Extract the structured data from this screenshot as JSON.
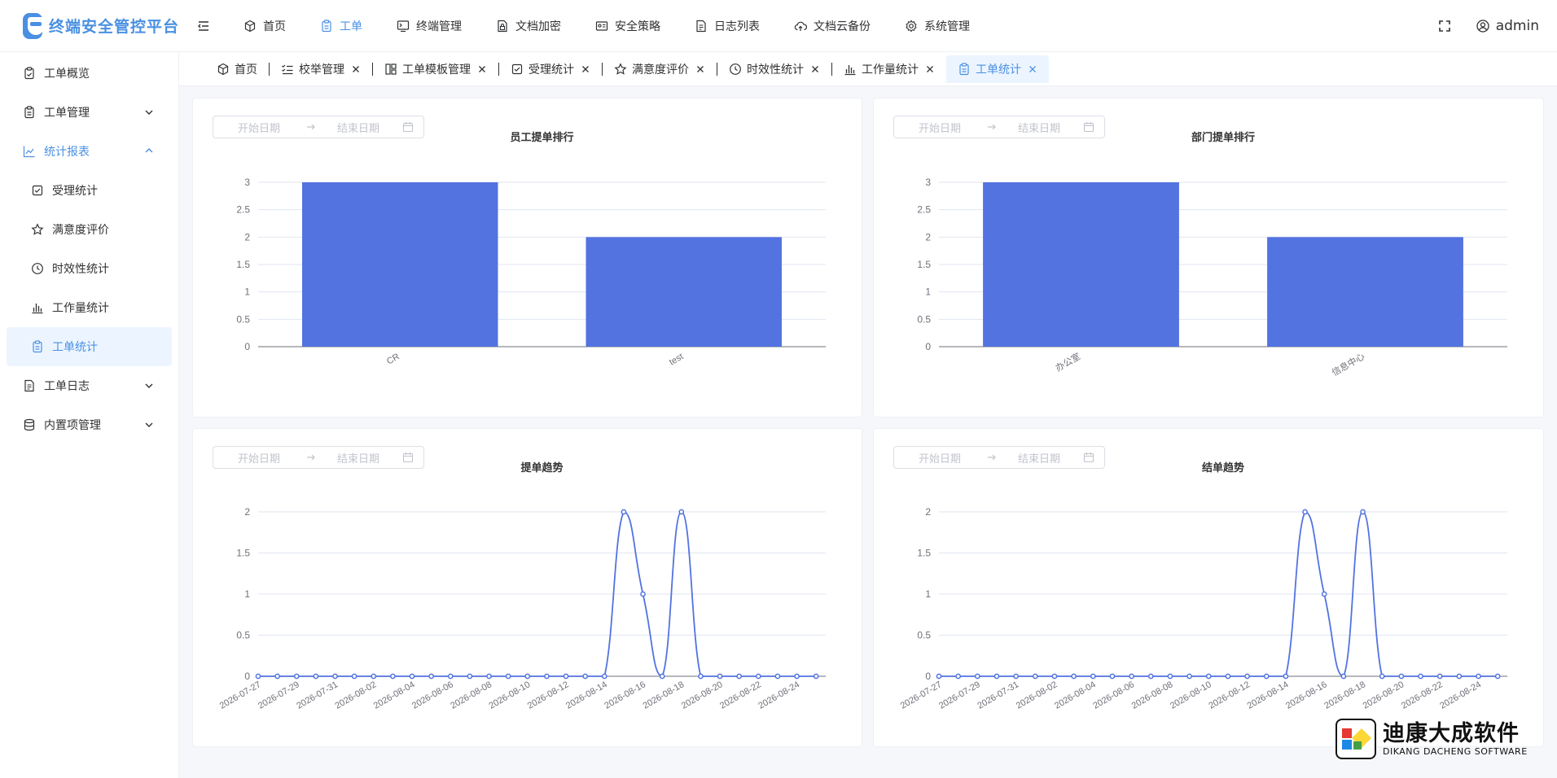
{
  "app": {
    "title": "终端安全管控平台"
  },
  "topnav": [
    {
      "label": "首页",
      "icon": "cube-icon"
    },
    {
      "label": "工单",
      "icon": "clipboard-icon",
      "active": true
    },
    {
      "label": "终端管理",
      "icon": "monitor-icon"
    },
    {
      "label": "文档加密",
      "icon": "lock-file-icon"
    },
    {
      "label": "安全策略",
      "icon": "id-card-icon"
    },
    {
      "label": "日志列表",
      "icon": "document-icon"
    },
    {
      "label": "文档云备份",
      "icon": "cloud-upload-icon"
    },
    {
      "label": "系统管理",
      "icon": "gear-icon"
    }
  ],
  "user": {
    "name": "admin"
  },
  "sidebar": {
    "items": [
      {
        "label": "工单概览",
        "icon": "clipboard-check-icon",
        "expandable": false
      },
      {
        "label": "工单管理",
        "icon": "clipboard-icon",
        "expandable": true
      },
      {
        "label": "统计报表",
        "icon": "line-chart-icon",
        "expandable": true,
        "open": true
      }
    ],
    "subitems": [
      {
        "label": "受理统计",
        "icon": "check-square-icon"
      },
      {
        "label": "满意度评价",
        "icon": "star-icon"
      },
      {
        "label": "时效性统计",
        "icon": "clock-icon"
      },
      {
        "label": "工作量统计",
        "icon": "bar-chart-icon"
      },
      {
        "label": "工单统计",
        "icon": "clipboard-icon",
        "active": true
      }
    ],
    "after": [
      {
        "label": "工单日志",
        "icon": "document-icon",
        "expandable": true
      },
      {
        "label": "内置项管理",
        "icon": "database-icon",
        "expandable": true
      }
    ]
  },
  "tabs": [
    {
      "label": "首页",
      "icon": "cube-icon",
      "closable": false
    },
    {
      "label": "校举管理",
      "icon": "list-check-icon",
      "closable": true
    },
    {
      "label": "工单模板管理",
      "icon": "template-icon",
      "closable": true
    },
    {
      "label": "受理统计",
      "icon": "check-square-icon",
      "closable": true
    },
    {
      "label": "满意度评价",
      "icon": "star-icon",
      "closable": true
    },
    {
      "label": "时效性统计",
      "icon": "clock-icon",
      "closable": true
    },
    {
      "label": "工作量统计",
      "icon": "bar-chart-icon",
      "closable": true
    },
    {
      "label": "工单统计",
      "icon": "clipboard-icon",
      "closable": true,
      "active": true
    }
  ],
  "date_filter": {
    "start_placeholder": "开始日期",
    "end_placeholder": "结束日期"
  },
  "colors": {
    "accent": "#4a90e2",
    "series": "#5273e0",
    "grid": "#e0e6f1",
    "axis": "#6e7079"
  },
  "chart_data": [
    {
      "type": "bar",
      "title": "员工提单排行",
      "categories": [
        "CR",
        "test"
      ],
      "values": [
        3,
        2
      ],
      "ylim": [
        0,
        3
      ],
      "yticks": [
        "0",
        "0.5",
        "1",
        "1.5",
        "2",
        "2.5",
        "3"
      ]
    },
    {
      "type": "bar",
      "title": "部门提单排行",
      "categories": [
        "办公室",
        "信息中心"
      ],
      "values": [
        3,
        2
      ],
      "ylim": [
        0,
        3
      ],
      "yticks": [
        "0",
        "0.5",
        "1",
        "1.5",
        "2",
        "2.5",
        "3"
      ]
    },
    {
      "type": "line",
      "title": "提单趋势",
      "x": [
        "2026-07-27",
        "2026-07-28",
        "2026-07-29",
        "2026-07-30",
        "2026-07-31",
        "2026-08-01",
        "2026-08-02",
        "2026-08-03",
        "2026-08-04",
        "2026-08-05",
        "2026-08-06",
        "2026-08-07",
        "2026-08-08",
        "2026-08-09",
        "2026-08-10",
        "2026-08-11",
        "2026-08-12",
        "2026-08-13",
        "2026-08-14",
        "2026-08-15",
        "2026-08-16",
        "2026-08-17",
        "2026-08-18",
        "2026-08-19",
        "2026-08-20",
        "2026-08-21",
        "2026-08-22",
        "2026-08-23",
        "2026-08-24",
        "2026-08-25"
      ],
      "values": [
        0,
        0,
        0,
        0,
        0,
        0,
        0,
        0,
        0,
        0,
        0,
        0,
        0,
        0,
        0,
        0,
        0,
        0,
        0,
        2,
        1,
        0,
        2,
        0,
        0,
        0,
        0,
        0,
        0,
        0
      ],
      "xtick_labels": [
        "2026-07-27",
        "2026-07-29",
        "2026-07-31",
        "2026-08-02",
        "2026-08-04",
        "2026-08-06",
        "2026-08-08",
        "2026-08-10",
        "2026-08-12",
        "2026-08-14",
        "2026-08-16",
        "2026-08-18",
        "2026-08-20",
        "2026-08-22",
        "2026-08-24"
      ],
      "ylim": [
        0,
        2
      ],
      "yticks": [
        "0",
        "0.5",
        "1",
        "1.5",
        "2"
      ]
    },
    {
      "type": "line",
      "title": "结单趋势",
      "x": [
        "2026-07-27",
        "2026-07-28",
        "2026-07-29",
        "2026-07-30",
        "2026-07-31",
        "2026-08-01",
        "2026-08-02",
        "2026-08-03",
        "2026-08-04",
        "2026-08-05",
        "2026-08-06",
        "2026-08-07",
        "2026-08-08",
        "2026-08-09",
        "2026-08-10",
        "2026-08-11",
        "2026-08-12",
        "2026-08-13",
        "2026-08-14",
        "2026-08-15",
        "2026-08-16",
        "2026-08-17",
        "2026-08-18",
        "2026-08-19",
        "2026-08-20",
        "2026-08-21",
        "2026-08-22",
        "2026-08-23",
        "2026-08-24",
        "2026-08-25"
      ],
      "values": [
        0,
        0,
        0,
        0,
        0,
        0,
        0,
        0,
        0,
        0,
        0,
        0,
        0,
        0,
        0,
        0,
        0,
        0,
        0,
        2,
        1,
        0,
        2,
        0,
        0,
        0,
        0,
        0,
        0,
        0
      ],
      "xtick_labels": [
        "2026-07-27",
        "2026-07-29",
        "2026-07-31",
        "2026-08-02",
        "2026-08-04",
        "2026-08-06",
        "2026-08-08",
        "2026-08-10",
        "2026-08-12",
        "2026-08-14",
        "2026-08-16",
        "2026-08-18",
        "2026-08-20",
        "2026-08-22",
        "2026-08-24"
      ],
      "ylim": [
        0,
        2
      ],
      "yticks": [
        "0",
        "0.5",
        "1",
        "1.5",
        "2"
      ]
    }
  ],
  "watermark": {
    "cn": "迪康大成软件",
    "en": "DIKANG DACHENG SOFTWARE"
  }
}
